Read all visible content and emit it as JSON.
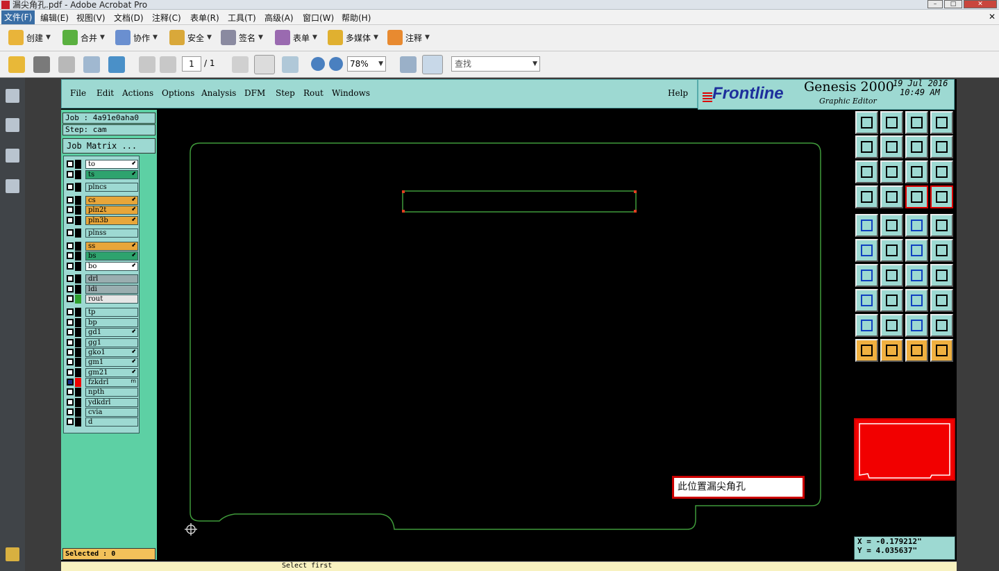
{
  "window": {
    "title": "漏尖角孔.pdf - Adobe Acrobat Pro"
  },
  "menu": [
    "文件(F)",
    "编辑(E)",
    "视图(V)",
    "文档(D)",
    "注释(C)",
    "表单(R)",
    "工具(T)",
    "高级(A)",
    "窗口(W)",
    "帮助(H)"
  ],
  "toolbar1": [
    "创建",
    "合并",
    "协作",
    "安全",
    "签名",
    "表单",
    "多媒体",
    "注释"
  ],
  "toolbar2": {
    "page_current": "1",
    "page_total": "/ 1",
    "zoom": "78%",
    "search_placeholder": "查找"
  },
  "genesis": {
    "menu": [
      "File",
      "Edit",
      "Actions",
      "Options",
      "Analysis",
      "DFM",
      "Step",
      "Rout",
      "Windows"
    ],
    "help": "Help",
    "brand": "Frontline",
    "product": "Genesis 2000",
    "subtitle": "Graphic Editor",
    "date": "19 Jul 2016",
    "time": "10:49 AM",
    "job": "Job : 4a91e0aha0",
    "step": "Step: cam",
    "job_matrix": "Job Matrix ...",
    "selected": "Selected : 0",
    "coord_x": "X = -0.179212\"",
    "coord_y": "Y = 4.035637\"",
    "note": "此位置漏尖角孔",
    "status_text": "Select first"
  },
  "layers": [
    {
      "name": "to",
      "color": "#ffffff",
      "flag": "⬋"
    },
    {
      "name": "ts",
      "color": "#2ea36e",
      "flag": "⬋"
    },
    {
      "name": "plncs",
      "color": "#9dd9d2",
      "flag": ""
    },
    {
      "name": "cs",
      "color": "#e8a63a",
      "flag": "⬋"
    },
    {
      "name": "pln2t",
      "color": "#e8a63a",
      "flag": "⬋"
    },
    {
      "name": "pln3b",
      "color": "#e8a63a",
      "flag": "⬋"
    },
    {
      "name": "plnss",
      "color": "#9dd9d2",
      "flag": ""
    },
    {
      "name": "ss",
      "color": "#e8a63a",
      "flag": "⬋"
    },
    {
      "name": "bs",
      "color": "#2ea36e",
      "flag": "⬋"
    },
    {
      "name": "bo",
      "color": "#ffffff",
      "flag": "⬋"
    },
    {
      "name": "drl",
      "color": "#9aaeb0",
      "flag": ""
    },
    {
      "name": "ldi",
      "color": "#9aaeb0",
      "flag": ""
    },
    {
      "name": "rout",
      "color": "#e6e6e6",
      "flag": ""
    },
    {
      "name": "tp",
      "color": "#9dd9d2",
      "flag": ""
    },
    {
      "name": "bp",
      "color": "#9dd9d2",
      "flag": ""
    },
    {
      "name": "gd1",
      "color": "#9dd9d2",
      "flag": "⬋"
    },
    {
      "name": "gg1",
      "color": "#9dd9d2",
      "flag": ""
    },
    {
      "name": "gko1",
      "color": "#9dd9d2",
      "flag": "⬋"
    },
    {
      "name": "gm1",
      "color": "#9dd9d2",
      "flag": "⬋"
    },
    {
      "name": "gm21",
      "color": "#9dd9d2",
      "flag": "⬋"
    },
    {
      "name": "fzkdrl",
      "color": "#9dd9d2",
      "flag": "m"
    },
    {
      "name": "npth",
      "color": "#9dd9d2",
      "flag": ""
    },
    {
      "name": "ydkdrl",
      "color": "#9dd9d2",
      "flag": ""
    },
    {
      "name": "cvia",
      "color": "#9dd9d2",
      "flag": ""
    },
    {
      "name": "d",
      "color": "#9dd9d2",
      "flag": ""
    }
  ]
}
